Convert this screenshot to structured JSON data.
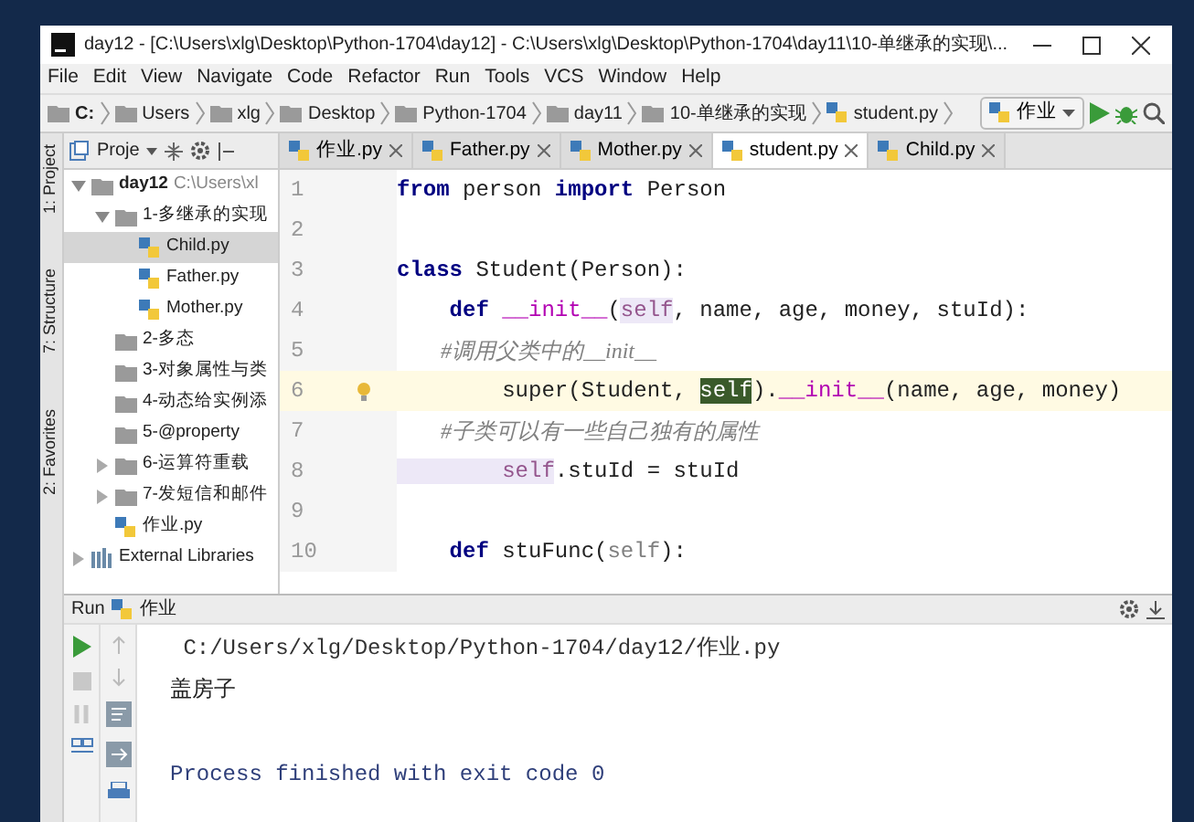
{
  "window": {
    "title": "day12 - [C:\\Users\\xlg\\Desktop\\Python-1704\\day12] - C:\\Users\\xlg\\Desktop\\Python-1704\\day11\\10-单继承的实现\\..."
  },
  "menu": [
    "File",
    "Edit",
    "View",
    "Navigate",
    "Code",
    "Refactor",
    "Run",
    "Tools",
    "VCS",
    "Window",
    "Help"
  ],
  "breadcrumbs": [
    {
      "label": "C:",
      "kind": "drive"
    },
    {
      "label": "Users",
      "kind": "folder"
    },
    {
      "label": "xlg",
      "kind": "folder"
    },
    {
      "label": "Desktop",
      "kind": "folder"
    },
    {
      "label": "Python-1704",
      "kind": "folder"
    },
    {
      "label": "day11",
      "kind": "folder"
    },
    {
      "label": "10-单继承的实现",
      "kind": "folder"
    },
    {
      "label": "student.py",
      "kind": "file"
    }
  ],
  "run_config": "作业",
  "side_strip": [
    "1: Project",
    "7: Structure",
    "2: Favorites"
  ],
  "project": {
    "title": "Proje",
    "tree": [
      {
        "label": "day12",
        "path": "C:\\Users\\xl",
        "kind": "folder",
        "expanded": true,
        "selected": false,
        "children": [
          {
            "label": "1-多继承的实现",
            "kind": "folder",
            "expanded": true,
            "selected": false,
            "children": [
              {
                "label": "Child.py",
                "kind": "file",
                "selected": true
              },
              {
                "label": "Father.py",
                "kind": "file",
                "selected": false
              },
              {
                "label": "Mother.py",
                "kind": "file",
                "selected": false
              }
            ]
          },
          {
            "label": "2-多态",
            "kind": "folder",
            "selected": false
          },
          {
            "label": "3-对象属性与类",
            "kind": "folder",
            "selected": false
          },
          {
            "label": "4-动态给实例添",
            "kind": "folder",
            "selected": false
          },
          {
            "label": "5-@property",
            "kind": "folder",
            "selected": false
          },
          {
            "label": "6-运算符重载",
            "kind": "folder",
            "expanded": false,
            "selected": false
          },
          {
            "label": "7-发短信和邮件",
            "kind": "folder",
            "expanded": false,
            "selected": false
          },
          {
            "label": "作业.py",
            "kind": "file",
            "selected": false
          }
        ]
      },
      {
        "label": "External Libraries",
        "kind": "library",
        "expanded": false,
        "selected": false
      }
    ]
  },
  "tabs": [
    {
      "label": "作业.py",
      "selected": false
    },
    {
      "label": "Father.py",
      "selected": false
    },
    {
      "label": "Mother.py",
      "selected": false
    },
    {
      "label": "student.py",
      "selected": true
    },
    {
      "label": "Child.py",
      "selected": false
    }
  ],
  "editor": {
    "lines": [
      {
        "number": "1",
        "current": false,
        "tokens": [
          {
            "kind": "keyword",
            "text": "from"
          },
          {
            "kind": "plain",
            "text": " person "
          },
          {
            "kind": "keyword",
            "text": "import"
          },
          {
            "kind": "plain",
            "text": " Person"
          }
        ]
      },
      {
        "number": "2",
        "current": false
      },
      {
        "number": "3",
        "current": false,
        "tokens": [
          {
            "kind": "keyword",
            "text": "class"
          },
          {
            "kind": "plain",
            "text": " Student(Person):"
          }
        ]
      },
      {
        "number": "4",
        "current": false,
        "tokens": [
          {
            "kind": "keyword",
            "text": "    def "
          },
          {
            "kind": "dunder",
            "text": "__init__"
          },
          {
            "kind": "plain",
            "text": "("
          },
          {
            "kind": "self",
            "text": "self"
          },
          {
            "kind": "plain",
            "text": ", name, age, money, stuId):"
          }
        ]
      },
      {
        "number": "5",
        "current": false,
        "tokens": [
          {
            "kind": "comment",
            "text": "        #调用父类中的__init__"
          }
        ]
      },
      {
        "number": "6",
        "current": true,
        "tokens": [
          {
            "kind": "plain",
            "text": "        super(Student, "
          },
          {
            "kind": "selection",
            "text": "self"
          },
          {
            "kind": "plain",
            "text": ")."
          },
          {
            "kind": "dunder",
            "text": "__init__"
          },
          {
            "kind": "plain",
            "text": "(name, age, money)"
          }
        ]
      },
      {
        "number": "7",
        "current": false,
        "tokens": [
          {
            "kind": "comment",
            "text": "        #子类可以有一些自己独有的属性"
          }
        ]
      },
      {
        "number": "8",
        "current": false,
        "tokens": [
          {
            "kind": "self",
            "text": "        self"
          },
          {
            "kind": "plain",
            "text": ".stuId = stuId"
          }
        ]
      },
      {
        "number": "9",
        "current": false
      },
      {
        "number": "10",
        "current": false,
        "tokens": [
          {
            "kind": "keyword",
            "text": "    def"
          },
          {
            "kind": "plain",
            "text": " stuFunc("
          },
          {
            "kind": "param",
            "text": "self"
          },
          {
            "kind": "plain",
            "text": "):"
          }
        ]
      }
    ]
  },
  "run": {
    "title": "Run",
    "config": "作业",
    "output": [
      {
        "kind": "command",
        "text": " C:/Users/xlg/Desktop/Python-1704/day12/作业.py"
      },
      {
        "kind": "stdout",
        "text": "盖房子"
      },
      {
        "kind": "blank"
      },
      {
        "kind": "exit",
        "text": "Process finished with exit code 0"
      }
    ]
  }
}
